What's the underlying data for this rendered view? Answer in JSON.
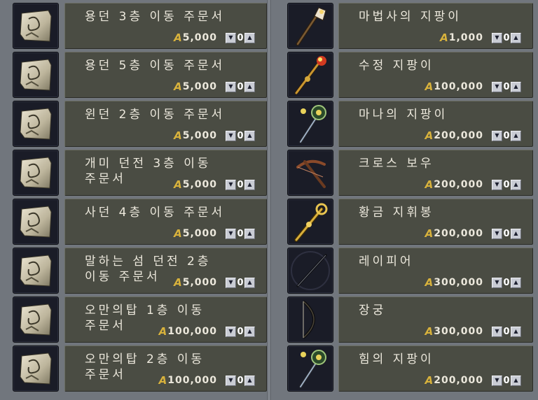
{
  "left_items": [
    {
      "name": "용던 3층 이동 주문서",
      "price": "5,000",
      "qty": "0",
      "icon": "scroll-icon"
    },
    {
      "name": "용던 5층 이동 주문서",
      "price": "5,000",
      "qty": "0",
      "icon": "scroll-icon"
    },
    {
      "name": "윈던 2층 이동 주문서",
      "price": "5,000",
      "qty": "0",
      "icon": "scroll-icon"
    },
    {
      "name": "개미 던전 3층 이동\n주문서",
      "price": "5,000",
      "qty": "0",
      "icon": "scroll-icon"
    },
    {
      "name": "사던 4층 이동 주문서",
      "price": "5,000",
      "qty": "0",
      "icon": "scroll-icon"
    },
    {
      "name": "말하는 섬 던전 2층\n이동 주문서",
      "price": "5,000",
      "qty": "0",
      "icon": "scroll-icon"
    },
    {
      "name": "오만의탑 1층 이동\n주문서",
      "price": "100,000",
      "qty": "0",
      "icon": "scroll-icon"
    },
    {
      "name": "오만의탑 2층 이동\n주문서",
      "price": "100,000",
      "qty": "0",
      "icon": "scroll-icon"
    }
  ],
  "right_items": [
    {
      "name": "마법사의 지팡이",
      "price": "1,000",
      "qty": "0",
      "icon": "wizard-staff-icon"
    },
    {
      "name": "수정 지팡이",
      "price": "100,000",
      "qty": "0",
      "icon": "crystal-staff-icon"
    },
    {
      "name": "마나의 지팡이",
      "price": "200,000",
      "qty": "0",
      "icon": "mana-staff-icon"
    },
    {
      "name": "크로스 보우",
      "price": "200,000",
      "qty": "0",
      "icon": "crossbow-icon"
    },
    {
      "name": "황금 지휘봉",
      "price": "200,000",
      "qty": "0",
      "icon": "golden-scepter-icon"
    },
    {
      "name": "레이피어",
      "price": "300,000",
      "qty": "0",
      "icon": "rapier-icon"
    },
    {
      "name": "장궁",
      "price": "300,000",
      "qty": "0",
      "icon": "longbow-icon"
    },
    {
      "name": "힘의 지팡이",
      "price": "200,000",
      "qty": "0",
      "icon": "staff-of-power-icon"
    }
  ],
  "currency_symbol": "A",
  "decrement_label": "▼",
  "increment_label": "▲"
}
